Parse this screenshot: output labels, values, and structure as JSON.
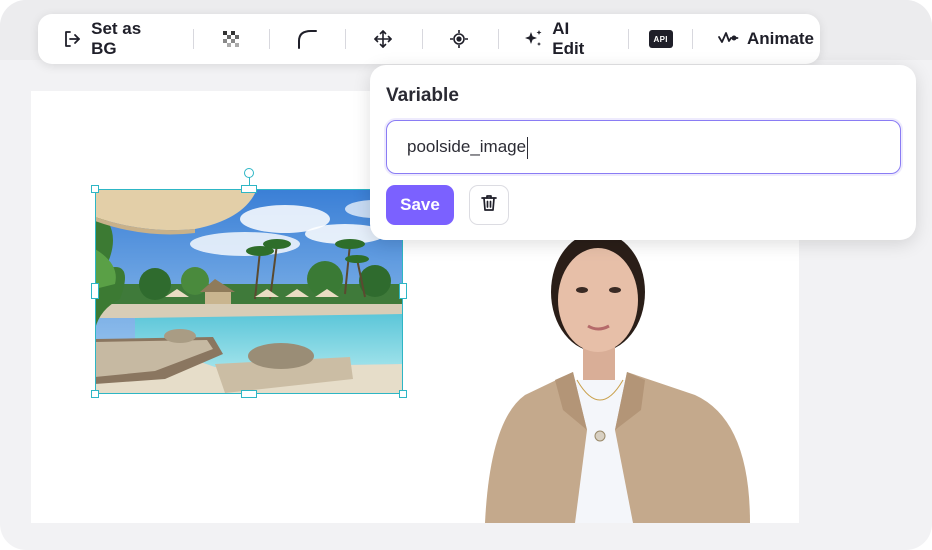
{
  "toolbar": {
    "set_as_bg_label": "Set as BG",
    "ai_edit_label": "AI Edit",
    "api_badge": "API",
    "animate_label": "Animate"
  },
  "popover": {
    "title": "Variable",
    "input_value": "poolside_image",
    "save_label": "Save"
  },
  "colors": {
    "accent": "#7b61ff",
    "selection": "#2db6c5",
    "input_border": "#8a7cf4"
  },
  "icons": [
    "exit-icon",
    "transparency-icon",
    "corner-radius-icon",
    "move-icon",
    "focus-icon",
    "sparkles-icon",
    "api-icon",
    "animate-icon",
    "trash-icon"
  ]
}
